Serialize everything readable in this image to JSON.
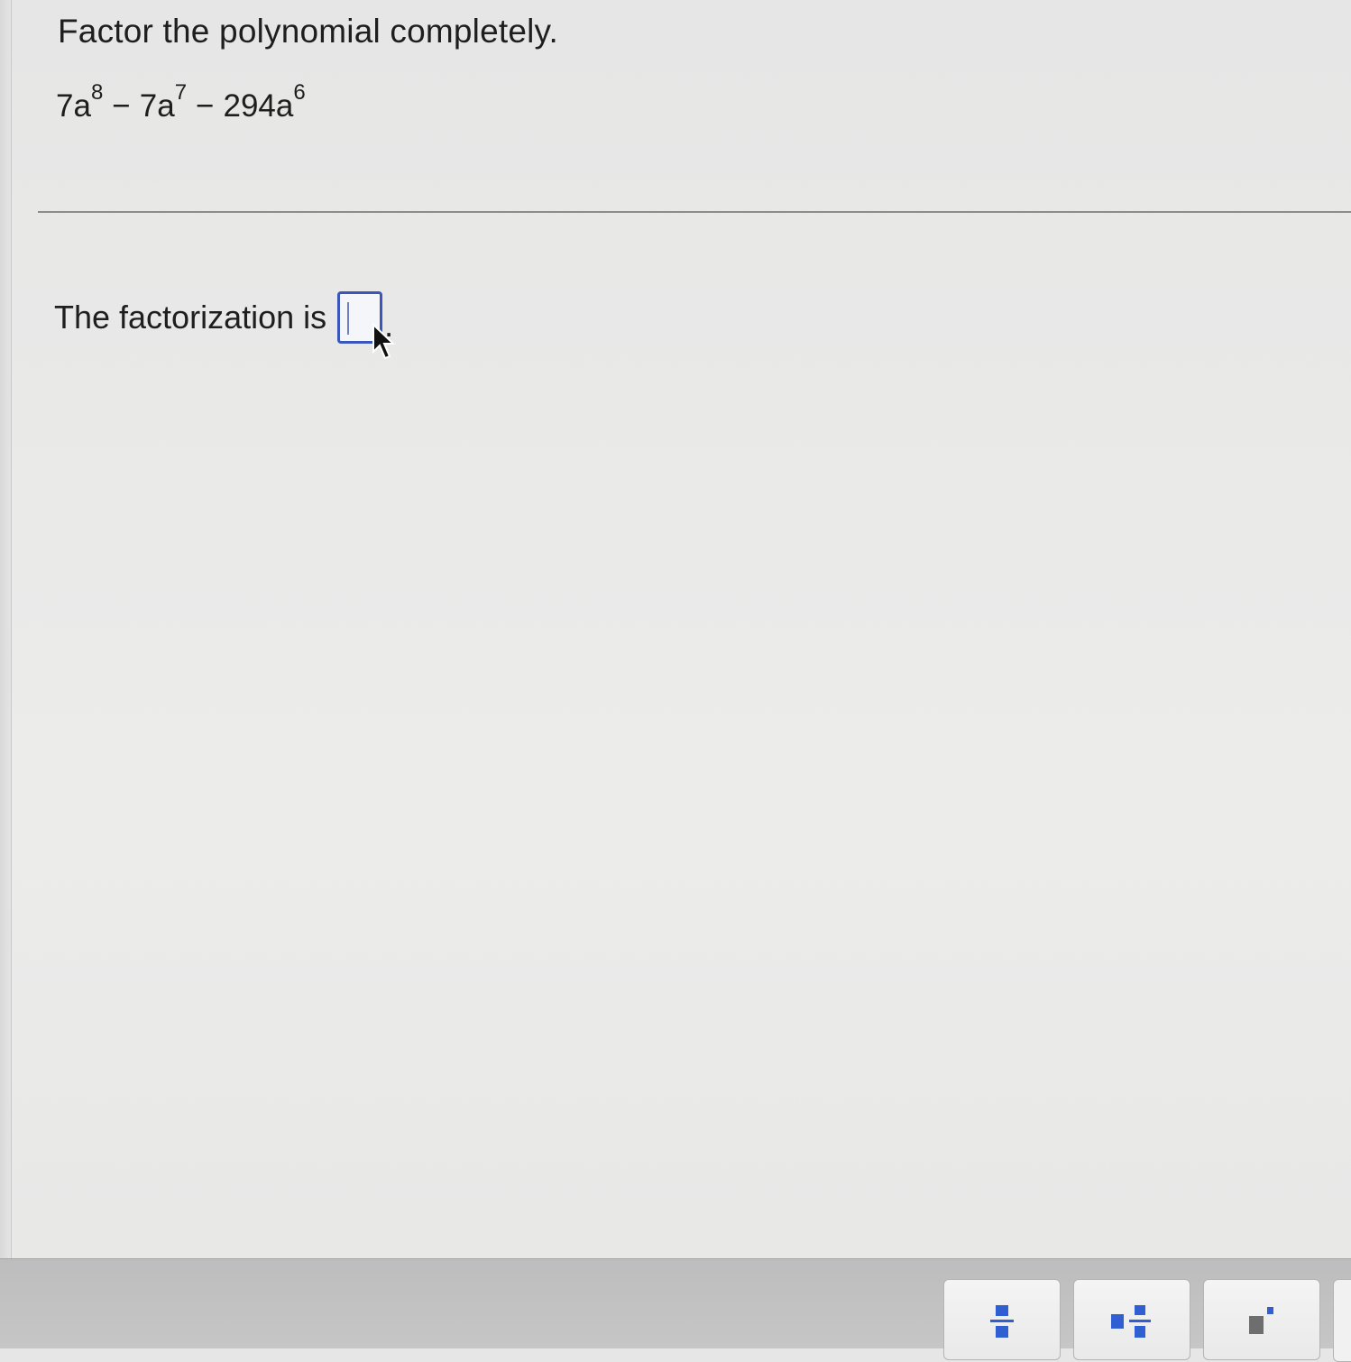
{
  "question": {
    "instruction": "Factor the polynomial completely.",
    "polynomial": {
      "term1_base": "7a",
      "term1_exp": "8",
      "op1": "−",
      "term2_base": "7a",
      "term2_exp": "7",
      "op2": "−",
      "term3_base": "294a",
      "term3_exp": "6"
    }
  },
  "answer": {
    "prompt": "The factorization is",
    "value": "",
    "period": "."
  },
  "toolbar": {
    "buttons": [
      {
        "icon": "fraction-icon"
      },
      {
        "icon": "mixed-number-icon"
      },
      {
        "icon": "exponent-icon"
      }
    ]
  },
  "colors": {
    "accent": "#3a56b8",
    "toolbar_icon": "#2f5fd0"
  }
}
